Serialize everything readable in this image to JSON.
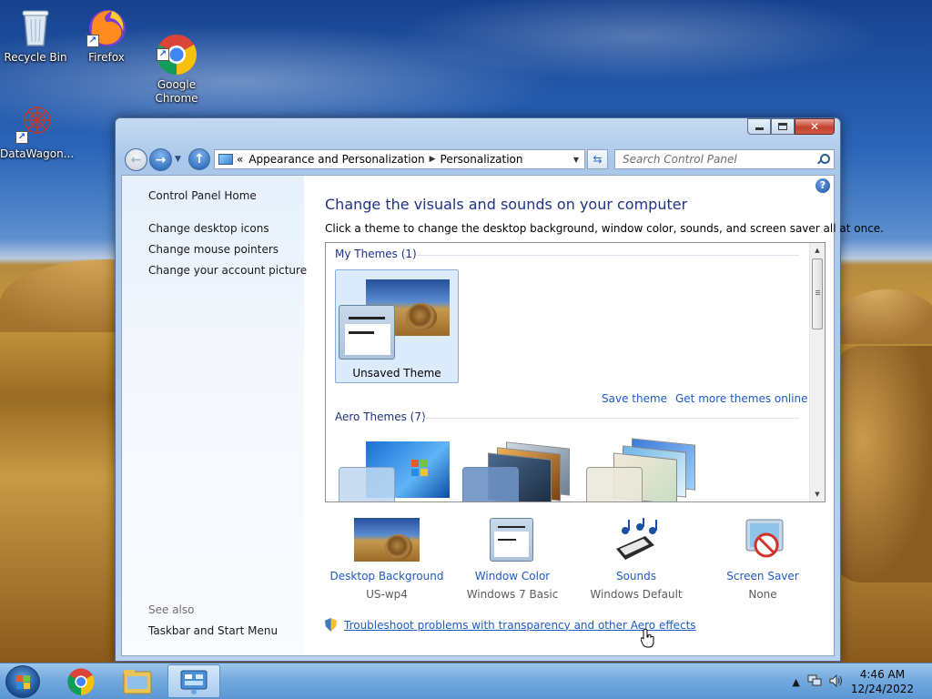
{
  "desktop": {
    "icons": [
      {
        "label": "Recycle Bin",
        "icon": "recycle-bin-icon"
      },
      {
        "label": "Firefox",
        "icon": "firefox-icon"
      },
      {
        "label": "Google\nChrome",
        "icon": "chrome-icon"
      },
      {
        "label": "DataWagon...",
        "icon": "datawagon-icon"
      }
    ]
  },
  "window": {
    "caption_buttons": {
      "minimize": "minimize",
      "maximize": "maximize",
      "close": "close"
    },
    "breadcrumb": {
      "overflow": "«",
      "items": [
        "Appearance and Personalization",
        "Personalization"
      ]
    },
    "search": {
      "placeholder": "Search Control Panel"
    },
    "sidebar": {
      "home": "Control Panel Home",
      "links": [
        "Change desktop icons",
        "Change mouse pointers",
        "Change your account picture"
      ],
      "see_also": "See also",
      "see_also_links": [
        "Taskbar and Start Menu"
      ]
    },
    "main": {
      "title": "Change the visuals and sounds on your computer",
      "subtitle": "Click a theme to change the desktop background, window color, sounds, and screen saver all at once.",
      "my_themes_header": "My Themes (1)",
      "my_themes": [
        {
          "label": "Unsaved Theme",
          "selected": true
        }
      ],
      "save_theme": "Save theme",
      "get_more": "Get more themes online",
      "aero_header": "Aero Themes (7)"
    },
    "bottom": [
      {
        "label": "Desktop Background",
        "value": "US-wp4",
        "icon": "desktop-background-icon"
      },
      {
        "label": "Window Color",
        "value": "Windows 7 Basic",
        "icon": "window-color-icon"
      },
      {
        "label": "Sounds",
        "value": "Windows Default",
        "icon": "sounds-icon"
      },
      {
        "label": "Screen Saver",
        "value": "None",
        "icon": "screen-saver-icon"
      }
    ],
    "troubleshoot": "Troubleshoot problems with transparency and other Aero effects"
  },
  "taskbar": {
    "clock": {
      "time": "4:46 AM",
      "date": "12/24/2022"
    },
    "tray": {
      "show_hidden": "▲"
    }
  },
  "colors": {
    "link": "#1d5bc6",
    "title": "#1e3287",
    "selection": "#dcebfc"
  }
}
